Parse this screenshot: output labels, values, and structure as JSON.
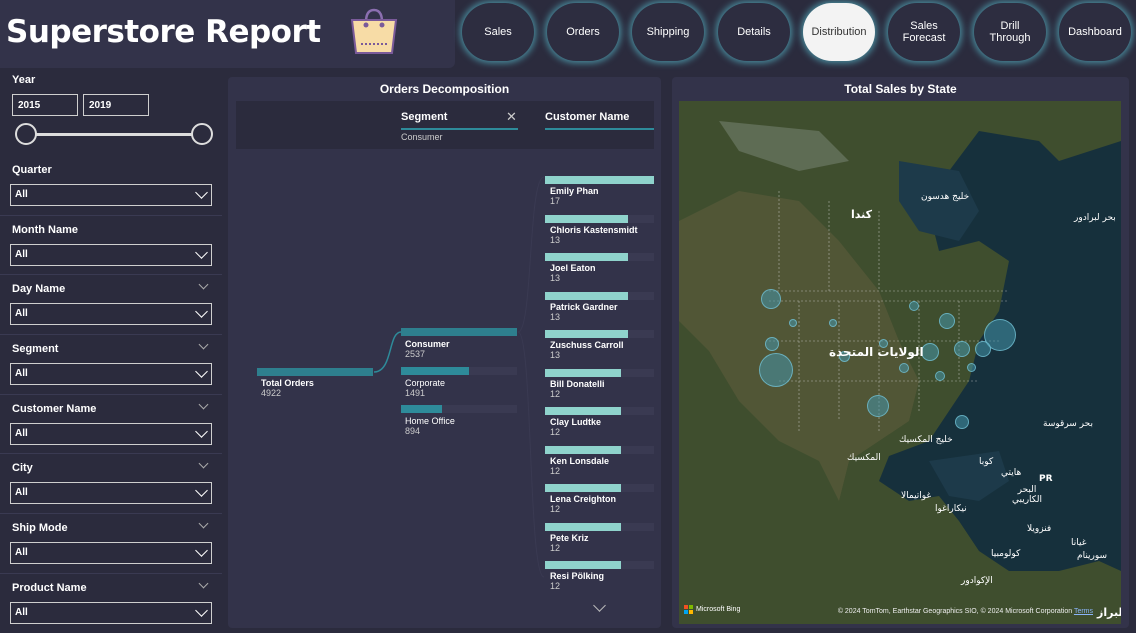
{
  "header": {
    "title": "Superstore Report"
  },
  "nav": [
    {
      "label": "Sales"
    },
    {
      "label": "Orders"
    },
    {
      "label": "Shipping"
    },
    {
      "label": "Details"
    },
    {
      "label": "Distribution"
    },
    {
      "label": "Sales Forecast"
    },
    {
      "label": "Drill Through"
    },
    {
      "label": "Dashboard"
    }
  ],
  "nav_active": "Distribution",
  "filters": {
    "year": {
      "label": "Year",
      "from": "2015",
      "to": "2019"
    },
    "quarter": {
      "label": "Quarter",
      "value": "All"
    },
    "month": {
      "label": "Month Name",
      "value": "All"
    },
    "day": {
      "label": "Day Name",
      "value": "All"
    },
    "segment": {
      "label": "Segment",
      "value": "All"
    },
    "customer": {
      "label": "Customer Name",
      "value": "All"
    },
    "city": {
      "label": "City",
      "value": "All"
    },
    "ship": {
      "label": "Ship Mode",
      "value": "All"
    },
    "product": {
      "label": "Product Name",
      "value": "All"
    }
  },
  "decomp": {
    "title": "Orders Decomposition",
    "col1": {
      "label": "Segment",
      "selected": "Consumer"
    },
    "col2": {
      "label": "Customer Name"
    },
    "root": {
      "label": "Total Orders",
      "value": "4922"
    },
    "segments": [
      {
        "label": "Consumer",
        "value": "2537",
        "share": 1.0
      },
      {
        "label": "Corporate",
        "value": "1491",
        "share": 0.59
      },
      {
        "label": "Home Office",
        "value": "894",
        "share": 0.35
      }
    ],
    "customers": [
      {
        "label": "Emily Phan",
        "value": "17",
        "share": 1.0
      },
      {
        "label": "Chloris Kastensmidt",
        "value": "13",
        "share": 0.76
      },
      {
        "label": "Joel Eaton",
        "value": "13",
        "share": 0.76
      },
      {
        "label": "Patrick Gardner",
        "value": "13",
        "share": 0.76
      },
      {
        "label": "Zuschuss Carroll",
        "value": "13",
        "share": 0.76
      },
      {
        "label": "Bill Donatelli",
        "value": "12",
        "share": 0.7
      },
      {
        "label": "Clay Ludtke",
        "value": "12",
        "share": 0.7
      },
      {
        "label": "Ken Lonsdale",
        "value": "12",
        "share": 0.7
      },
      {
        "label": "Lena Creighton",
        "value": "12",
        "share": 0.7
      },
      {
        "label": "Pete Kriz",
        "value": "12",
        "share": 0.7
      },
      {
        "label": "Resi Pölking",
        "value": "12",
        "share": 0.7
      }
    ]
  },
  "map": {
    "title": "Total Sales by State",
    "labels": {
      "canada": "كندا",
      "hudson": "خليج هدسون",
      "labrador": "بحر لبرادور",
      "usa": "الولايات المتحدة",
      "gulf": "خليج المكسيك",
      "mexico": "المكسيك",
      "sargasso": "بحر سرقوسة",
      "cuba": "كوبا",
      "haiti": "هايتي",
      "pr": "PR",
      "caribbean": "البحر الكاريبي",
      "guatemala": "غواتيمالا",
      "nicaragua": "نيكاراغوا",
      "venezuela": "فنزويلا",
      "colombia": "كولومبيا",
      "ecuador": "الإكوادور",
      "suriname": "سورينام",
      "guyana": "غيانا",
      "brazil": "البراز"
    },
    "attribution": "© 2024 TomTom, Earthstar Geographics SIO, © 2024 Microsoft Corporation",
    "terms": "Terms",
    "bing": "Microsoft Bing"
  },
  "colors": {
    "bg": "#2b2b3d",
    "panel": "#33334a",
    "accent": "#2e8b9a",
    "bar_light": "#8fd3cc",
    "bar_dark": "#2e7f8e"
  }
}
